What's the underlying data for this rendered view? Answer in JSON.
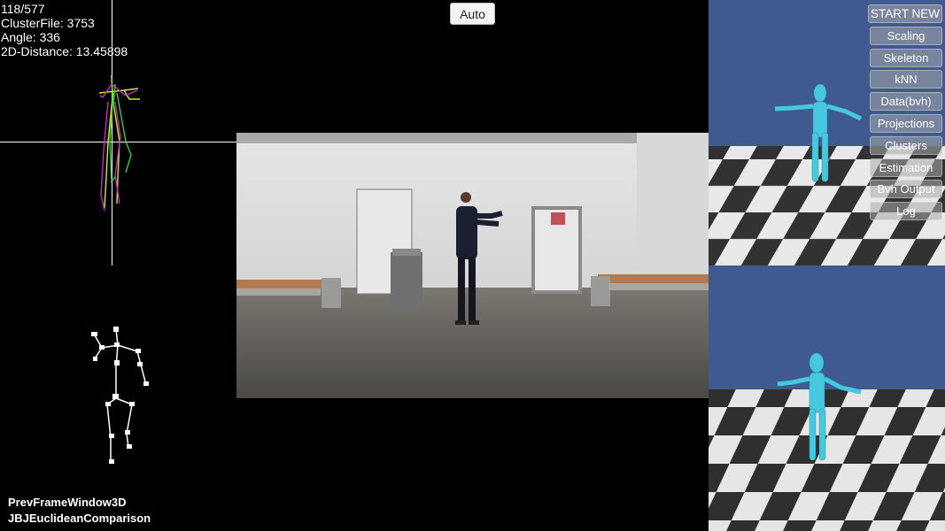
{
  "stats": {
    "frame": "118/577",
    "cluster_file": "ClusterFile: 3753",
    "angle": "Angle: 336",
    "distance": "2D-Distance: 13.45898"
  },
  "auto_button": "Auto",
  "menu": [
    {
      "label": "START NEW"
    },
    {
      "label": "Scaling"
    },
    {
      "label": "Skeleton"
    },
    {
      "label": "kNN"
    },
    {
      "label": "Data(bvh)"
    },
    {
      "label": "Projections"
    },
    {
      "label": "Clusters"
    },
    {
      "label": "Estimation"
    },
    {
      "label": "Bvh Output"
    },
    {
      "label": "Log"
    }
  ],
  "window_labels": {
    "prev_frame": "PrevFrameWindow3D",
    "comparison": "JBJEuclideanComparison"
  },
  "colors": {
    "sky": "#3e5a8f",
    "avatar": "#46c8e0",
    "skeleton_a": "#d4e83a",
    "skeleton_b": "#c230c8",
    "skeleton_c": "#3ecb46"
  }
}
